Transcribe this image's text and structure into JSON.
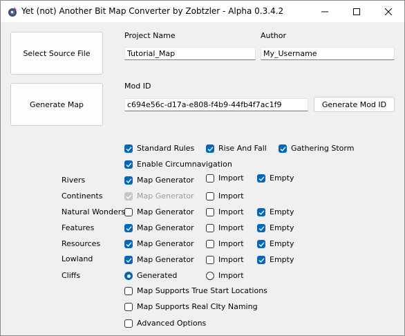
{
  "window": {
    "title": "Yet (not) Another Bit Map Converter by Zobtzler - Alpha 0.3.4.2",
    "controls": {
      "minimize": "–",
      "maximize": "☐",
      "close": "✕"
    }
  },
  "buttons": {
    "select_source": "Select Source File",
    "generate_map": "Generate Map",
    "generate_mod_id": "Generate Mod ID"
  },
  "fields": {
    "project_name_label": "Project Name",
    "project_name_value": "Tutorial_Map",
    "author_label": "Author",
    "author_value": "My_Username",
    "mod_id_label": "Mod ID",
    "mod_id_value": "c694e56c-d17a-e808-f4b9-44fb4f7ac1f9"
  },
  "rulesets": {
    "standard_rules": "Standard Rules",
    "rise_and_fall": "Rise And Fall",
    "gathering_storm": "Gathering Storm",
    "circumnavigation": "Enable Circumnavigation"
  },
  "rows": {
    "rivers": "Rivers",
    "continents": "Continents",
    "natural_wonders": "Natural Wonders",
    "features": "Features",
    "resources": "Resources",
    "lowland": "Lowland",
    "cliffs": "Cliffs"
  },
  "options": {
    "map_generator": "Map Generator",
    "import": "Import",
    "empty": "Empty",
    "generated": "Generated"
  },
  "extras": {
    "true_start": "Map Supports True Start Locations",
    "real_city": "Map Supports Real CIty Naming",
    "advanced": "Advanced Options"
  },
  "colors": {
    "accent": "#0067c0"
  }
}
